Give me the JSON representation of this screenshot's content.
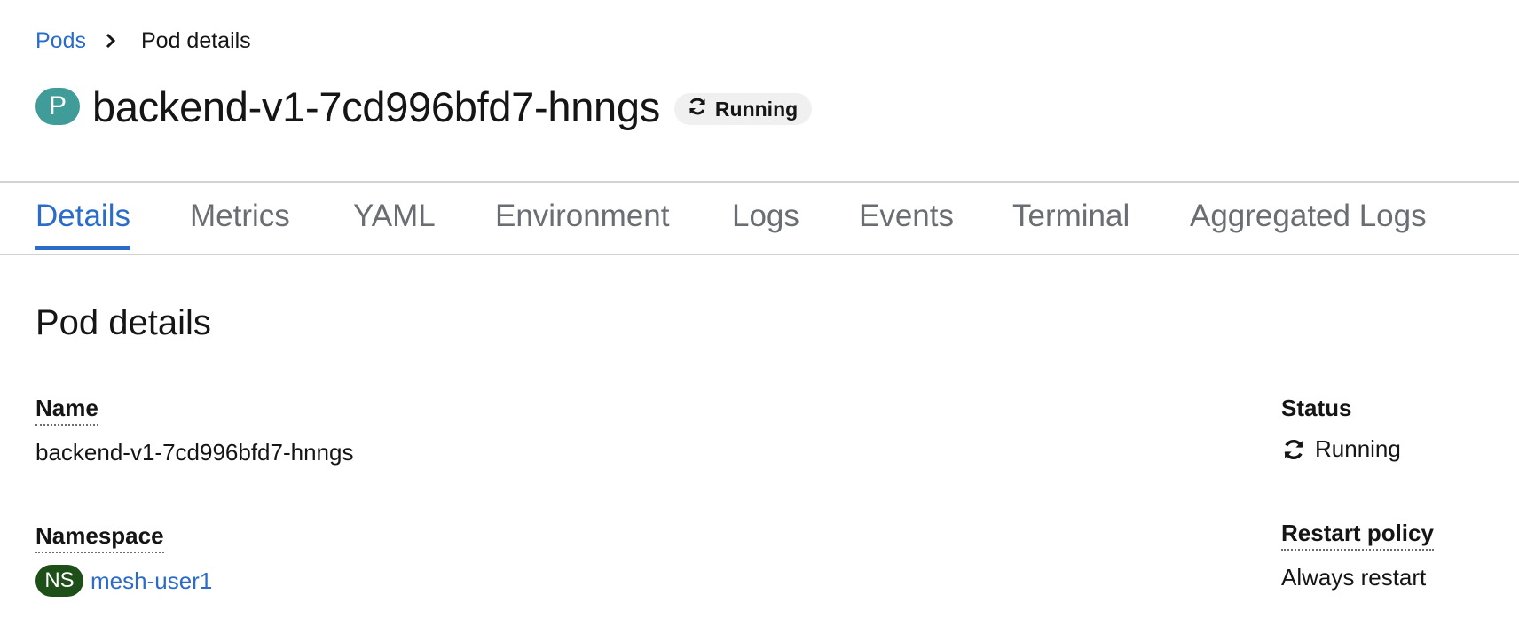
{
  "breadcrumb": {
    "parent": "Pods",
    "current": "Pod details"
  },
  "header": {
    "badge": "P",
    "title": "backend-v1-7cd996bfd7-hnngs",
    "status": "Running",
    "badge_color": "#3f9c98"
  },
  "tabs": [
    {
      "label": "Details",
      "active": true
    },
    {
      "label": "Metrics"
    },
    {
      "label": "YAML"
    },
    {
      "label": "Environment"
    },
    {
      "label": "Logs"
    },
    {
      "label": "Events"
    },
    {
      "label": "Terminal"
    },
    {
      "label": "Aggregated Logs"
    }
  ],
  "section": {
    "title": "Pod details"
  },
  "fields": {
    "name_label": "Name",
    "name_value": "backend-v1-7cd996bfd7-hnngs",
    "namespace_label": "Namespace",
    "namespace_badge": "NS",
    "namespace_value": "mesh-user1",
    "status_label": "Status",
    "status_value": "Running",
    "restart_label": "Restart policy",
    "restart_value": "Always restart"
  },
  "colors": {
    "link": "#2b6cc9",
    "namespace_badge": "#1e4f18"
  },
  "icons": {
    "breadcrumb_separator": "chevron-right-icon",
    "status": "sync-icon"
  }
}
